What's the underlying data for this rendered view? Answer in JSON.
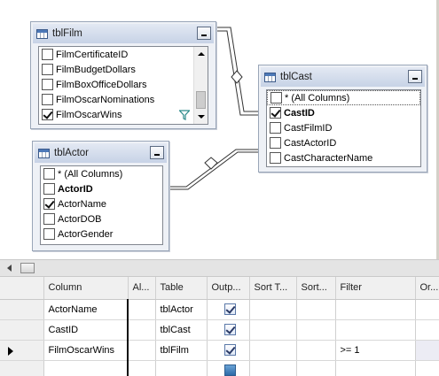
{
  "diagram": {
    "tables": [
      {
        "id": "tblFilm",
        "title": "tblFilm",
        "columns": [
          {
            "label": "FilmCertificateID",
            "checked": false,
            "bold": false
          },
          {
            "label": "FilmBudgetDollars",
            "checked": false,
            "bold": false
          },
          {
            "label": "FilmBoxOfficeDollars",
            "checked": false,
            "bold": false
          },
          {
            "label": "FilmOscarNominations",
            "checked": false,
            "bold": false
          },
          {
            "label": "FilmOscarWins",
            "checked": true,
            "bold": false,
            "filter_icon": "funnel-icon"
          }
        ]
      },
      {
        "id": "tblCast",
        "title": "tblCast",
        "columns": [
          {
            "label": "* (All Columns)",
            "checked": false,
            "bold": false
          },
          {
            "label": "CastID",
            "checked": true,
            "bold": true
          },
          {
            "label": "CastFilmID",
            "checked": false,
            "bold": false
          },
          {
            "label": "CastActorID",
            "checked": false,
            "bold": false
          },
          {
            "label": "CastCharacterName",
            "checked": false,
            "bold": false
          }
        ]
      },
      {
        "id": "tblActor",
        "title": "tblActor",
        "columns": [
          {
            "label": "* (All Columns)",
            "checked": false,
            "bold": false
          },
          {
            "label": "ActorID",
            "checked": false,
            "bold": true
          },
          {
            "label": "ActorName",
            "checked": true,
            "bold": false
          },
          {
            "label": "ActorDOB",
            "checked": false,
            "bold": false
          },
          {
            "label": "ActorGender",
            "checked": false,
            "bold": false
          }
        ]
      }
    ]
  },
  "grid": {
    "headers": [
      "Column",
      "Al...",
      "Table",
      "Outp...",
      "Sort T...",
      "Sort...",
      "Filter",
      "Or..."
    ],
    "rows": [
      {
        "column": "ActorName",
        "alias": "",
        "table": "tblActor",
        "output": true,
        "sort_type": "",
        "sort_order": "",
        "filter": "",
        "or": "",
        "current": false
      },
      {
        "column": "CastID",
        "alias": "",
        "table": "tblCast",
        "output": true,
        "sort_type": "",
        "sort_order": "",
        "filter": "",
        "or": "",
        "current": false
      },
      {
        "column": "FilmOscarWins",
        "alias": "",
        "table": "tblFilm",
        "output": true,
        "sort_type": "",
        "sort_order": "",
        "filter": ">= 1",
        "or": "",
        "current": true
      },
      {
        "column": "",
        "alias": "",
        "table": "",
        "output": null,
        "sort_type": "",
        "sort_order": "",
        "filter": "",
        "or": "",
        "current": false
      }
    ]
  },
  "colors": {
    "table_header": "#c7d3e6",
    "grid_header": "#f0f0f0",
    "output_checkbox_blue": "#2d6aa8"
  }
}
